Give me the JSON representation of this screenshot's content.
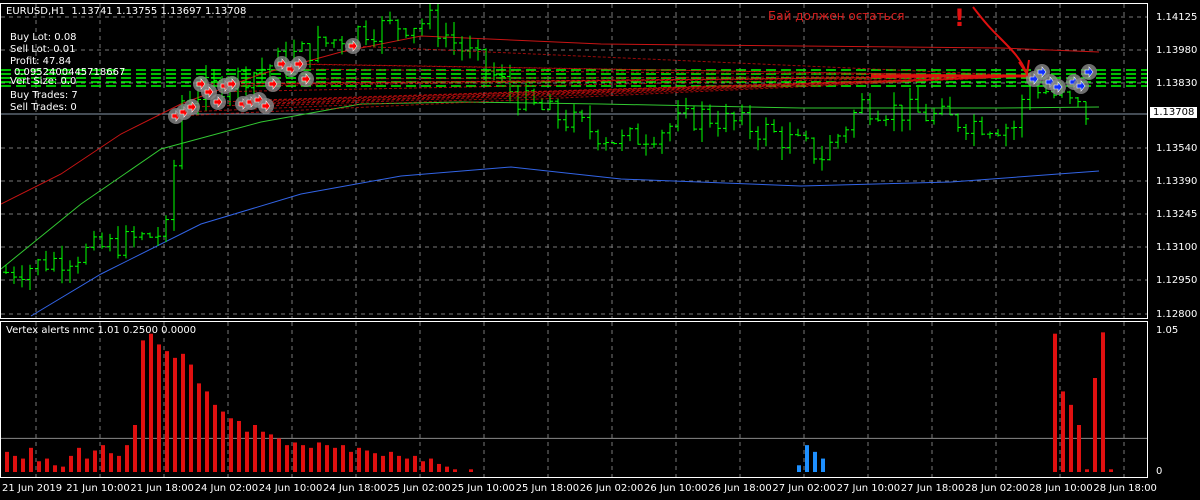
{
  "header": {
    "symbol": "EURUSD,H1",
    "ohlc": "1.13741 1.13755 1.13697 1.13708"
  },
  "info": {
    "buy_lot": "Buy Lot: 0.08",
    "sell_lot": "Sell Lot: 0.01",
    "profit": "Profit: 47.84",
    "overlap": "0.0952400445718667",
    "vert_size": "Vert Size: 0.0",
    "buy_trades": "Buy Trades: 7",
    "sell_trades": "Sell Trades: 0"
  },
  "annotation": {
    "text": "Бай должен остаться",
    "mark": "!"
  },
  "price_axis": {
    "labels": [
      "1.14125",
      "1.13980",
      "1.13830",
      "1.13540",
      "1.13390",
      "1.13245",
      "1.13100",
      "1.12950",
      "1.12800"
    ],
    "current": "1.13708",
    "max": 1.14125,
    "min": 1.128
  },
  "time_axis": [
    "21 Jun 2019",
    "21 Jun 10:00",
    "21 Jun 18:00",
    "24 Jun 02:00",
    "24 Jun 10:00",
    "24 Jun 18:00",
    "25 Jun 02:00",
    "25 Jun 10:00",
    "25 Jun 18:00",
    "26 Jun 02:00",
    "26 Jun 10:00",
    "26 Jun 18:00",
    "27 Jun 02:00",
    "27 Jun 10:00",
    "27 Jun 18:00",
    "28 Jun 02:00",
    "28 Jun 10:00",
    "28 Jun 18:00"
  ],
  "indicator": {
    "title": "Vertex alerts nmc 1.01 0.2500 0.0000",
    "max_label": "1.05",
    "min_label": "0",
    "level": 0.25,
    "max": 1.05
  },
  "colors": {
    "bull": "#00ff00",
    "red": "#e01010",
    "blue": "#1e90ff",
    "ma_red": "#c81414",
    "ma_green": "#32c832",
    "ma_blue": "#3264e6"
  },
  "chart_data": {
    "type": "candlestick",
    "price_path": [
      [
        0,
        1.13
      ],
      [
        20,
        1.1318
      ],
      [
        22,
        1.1377
      ],
      [
        37,
        1.1398
      ],
      [
        44,
        1.1408
      ],
      [
        53,
        1.1412
      ],
      [
        65,
        1.1375
      ],
      [
        77,
        1.1358
      ],
      [
        87,
        1.137
      ],
      [
        95,
        1.1363
      ],
      [
        102,
        1.1352
      ],
      [
        107,
        1.1375
      ],
      [
        118,
        1.1368
      ],
      [
        126,
        1.1365
      ],
      [
        128,
        1.1385
      ],
      [
        135,
        1.1371
      ]
    ],
    "histogram_values": [
      0.15,
      0.12,
      0.1,
      0.18,
      0.08,
      0.1,
      0.05,
      0.04,
      0.12,
      0.18,
      0.1,
      0.16,
      0.2,
      0.14,
      0.12,
      0.2,
      0.35,
      0.98,
      1.03,
      0.95,
      0.9,
      0.85,
      0.88,
      0.8,
      0.66,
      0.6,
      0.5,
      0.45,
      0.4,
      0.38,
      0.3,
      0.35,
      0.3,
      0.28,
      0.25,
      0.2,
      0.22,
      0.2,
      0.18,
      0.22,
      0.2,
      0.18,
      0.2,
      0.15,
      0.18,
      0.16,
      0.14,
      0.12,
      0.15,
      0.12,
      0.1,
      0.12,
      0.08,
      0.1,
      0.06,
      0.04,
      0.02,
      0.0,
      0.02,
      0,
      0,
      0,
      0,
      0,
      0,
      0,
      0,
      0,
      0,
      0,
      0,
      0,
      0,
      0,
      0,
      0,
      0,
      0,
      0,
      0,
      0,
      0,
      0,
      0,
      0,
      0,
      0,
      0,
      0,
      0,
      0,
      0,
      0,
      0,
      0,
      0,
      0,
      0,
      0,
      0.05,
      0.2,
      0.15,
      0.1,
      0,
      0,
      0,
      0,
      0,
      0,
      0,
      0,
      0,
      0,
      0,
      0,
      0,
      0,
      0,
      0,
      0,
      0,
      0,
      0,
      0,
      0,
      0,
      0,
      0,
      0,
      0,
      0,
      1.03,
      0.6,
      0.5,
      0.35,
      0.02,
      0.7,
      1.04,
      0.02
    ],
    "blue_bars": [
      99,
      100,
      101,
      102
    ]
  }
}
